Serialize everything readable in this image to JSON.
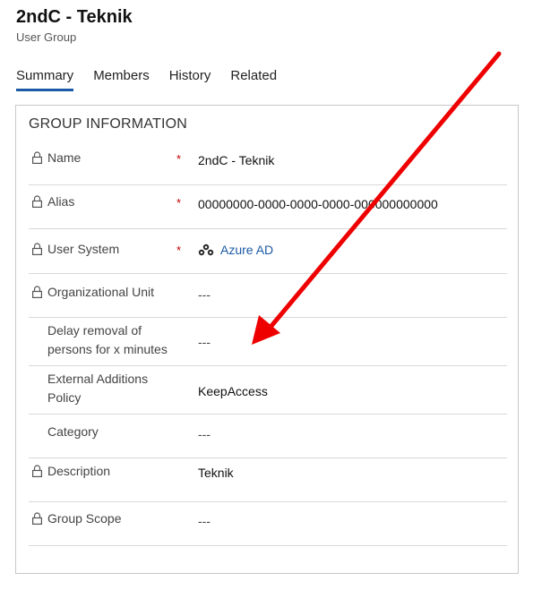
{
  "header": {
    "title": "2ndC - Teknik",
    "subtitle": "User Group"
  },
  "tabs": [
    {
      "label": "Summary",
      "active": true
    },
    {
      "label": "Members"
    },
    {
      "label": "History"
    },
    {
      "label": "Related"
    }
  ],
  "section": {
    "title": "GROUP INFORMATION"
  },
  "fields": [
    {
      "label": "Name",
      "locked": true,
      "required": true,
      "value": "2ndC - Teknik"
    },
    {
      "label": "Alias",
      "locked": true,
      "required": true,
      "value": "00000000-0000-0000-0000-000000000000"
    },
    {
      "label": "User System",
      "locked": true,
      "required": true,
      "value": "Azure AD",
      "icon": "azure-ad-icon"
    },
    {
      "label": "Organizational Unit",
      "locked": true,
      "required": false,
      "value": "---"
    },
    {
      "label_line1": "Delay removal of",
      "label_line2": "persons for x minutes",
      "locked": false,
      "required": false,
      "value": "---"
    },
    {
      "label_line1": "External Additions",
      "label_line2": "Policy",
      "locked": false,
      "required": false,
      "value": "KeepAccess"
    },
    {
      "label": "Category",
      "locked": false,
      "required": false,
      "value": "---"
    },
    {
      "label": "Description",
      "locked": true,
      "required": false,
      "value": "Teknik"
    },
    {
      "label": "Group Scope",
      "locked": true,
      "required": false,
      "value": "---"
    }
  ],
  "required_marker": "*",
  "colors": {
    "accent": "#1c5aa6",
    "required": "#c00000",
    "annotation_arrow": "#ee0000"
  }
}
